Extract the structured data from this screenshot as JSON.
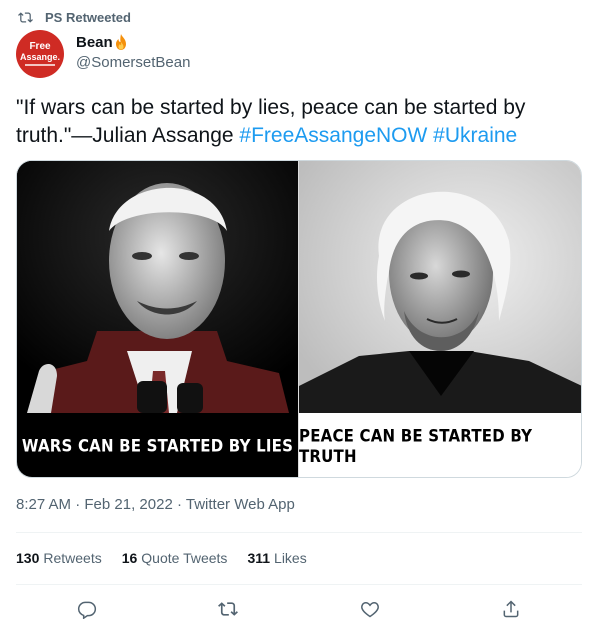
{
  "retweet": {
    "label": "PS Retweeted"
  },
  "author": {
    "avatar_line1": "Free",
    "avatar_line2": "Assange.",
    "name": "Bean",
    "handle": "@SomersetBean"
  },
  "tweet": {
    "text_main": "\"If wars can be started by lies, peace can be started by truth.\"—Julian Assange",
    "hashtag1": "#FreeAssangeNOW",
    "hashtag2": "#Ukraine"
  },
  "media": {
    "left_caption": "WARS CAN BE STARTED BY LIES",
    "right_caption": "PEACE CAN BE STARTED BY TRUTH"
  },
  "meta": {
    "time": "8:27 AM",
    "date": "Feb 21, 2022",
    "client": "Twitter Web App",
    "separator": "·"
  },
  "stats": {
    "retweets_count": "130",
    "retweets_label": "Retweets",
    "quotes_count": "16",
    "quotes_label": "Quote Tweets",
    "likes_count": "311",
    "likes_label": "Likes"
  },
  "icons": {
    "retweet_context": "retweet-icon",
    "name_emoji": "fire-icon",
    "reply": "reply-icon",
    "retweet": "retweet-icon",
    "like": "heart-icon",
    "share": "share-icon"
  },
  "colors": {
    "link": "#1d9bf0",
    "secondary": "#536471",
    "avatar_bg": "#cf2b24"
  }
}
